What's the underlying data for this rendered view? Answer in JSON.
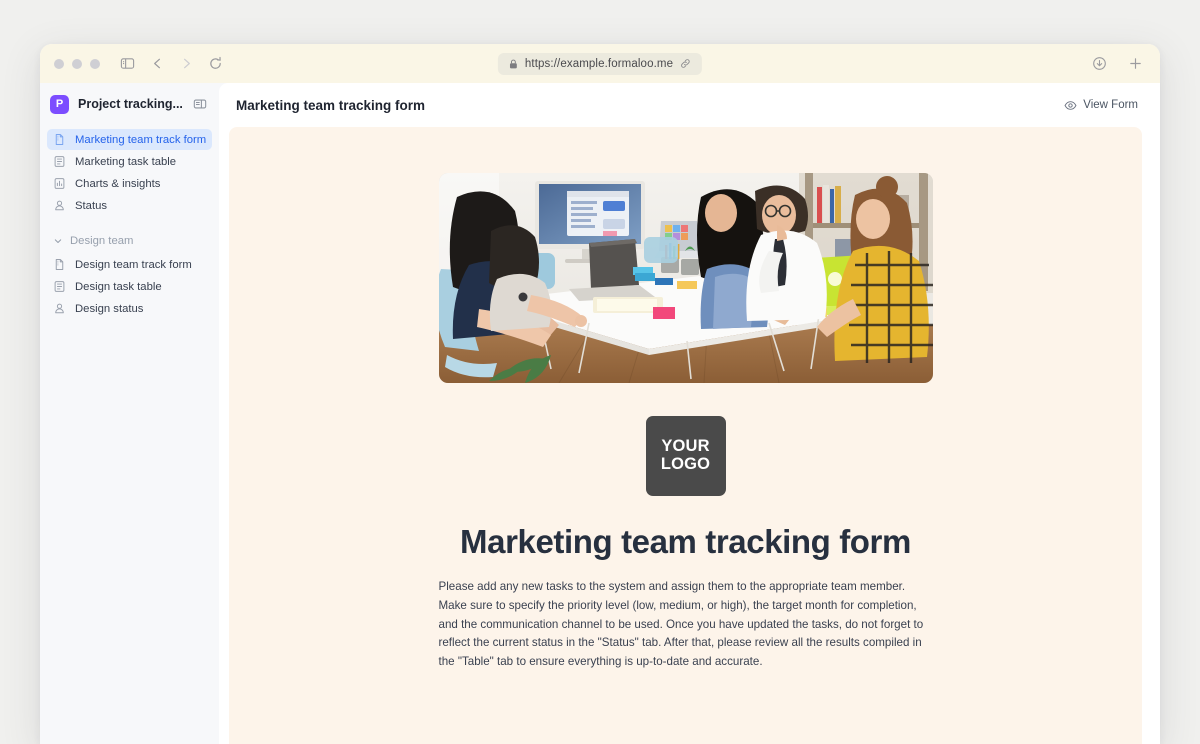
{
  "browser": {
    "url": "https://example.formaloo.me",
    "lock_icon": "lock-icon",
    "link_icon": "link-icon",
    "sidebar_toggle_icon": "sidebar-toggle-icon",
    "back_icon": "back-arrow-icon",
    "forward_icon": "forward-arrow-icon",
    "reload_icon": "reload-icon",
    "download_icon": "download-icon",
    "new_tab_icon": "plus-icon"
  },
  "workspace": {
    "badge_letter": "P",
    "name": "Project tracking...",
    "panel_toggle_icon": "panel-toggle-icon"
  },
  "sidebar": {
    "items": [
      {
        "label": "Marketing team track form",
        "icon": "form-file-icon",
        "active": true
      },
      {
        "label": "Marketing task table",
        "icon": "table-icon",
        "active": false
      },
      {
        "label": "Charts & insights",
        "icon": "bar-chart-icon",
        "active": false
      },
      {
        "label": "Status",
        "icon": "person-icon",
        "active": false
      }
    ],
    "group": {
      "label": "Design team",
      "chevron_icon": "chevron-down-icon",
      "items": [
        {
          "label": "Design team track form",
          "icon": "form-file-icon",
          "active": false
        },
        {
          "label": "Design task table",
          "icon": "table-icon",
          "active": false
        },
        {
          "label": "Design status",
          "icon": "person-icon",
          "active": false
        }
      ]
    }
  },
  "main": {
    "page_title": "Marketing team tracking form",
    "view_form_label": "View Form",
    "view_form_icon": "eye-icon"
  },
  "form": {
    "hero_image_alt": "team meeting around white table with laptops",
    "logo_line1": "YOUR",
    "logo_line2": "LOGO",
    "title": "Marketing team tracking form",
    "description": "Please add any new tasks to the system and assign them to the appropriate team member. Make sure to specify the priority level (low, medium, or high), the target month for completion, and the communication channel to be used. Once you have updated the tasks, do not forget to reflect the current status in the \"Status\" tab. After that, please review all the results compiled in the \"Table\" tab to ensure everything is up-to-date and accurate."
  },
  "colors": {
    "accent_blue": "#2563eb",
    "active_bg": "#dbe8fd",
    "brand_purple": "#7c4dff",
    "form_bg": "#fdf4ea",
    "toolbar_bg": "#faf6e6",
    "page_bg": "#f0f0ee"
  }
}
